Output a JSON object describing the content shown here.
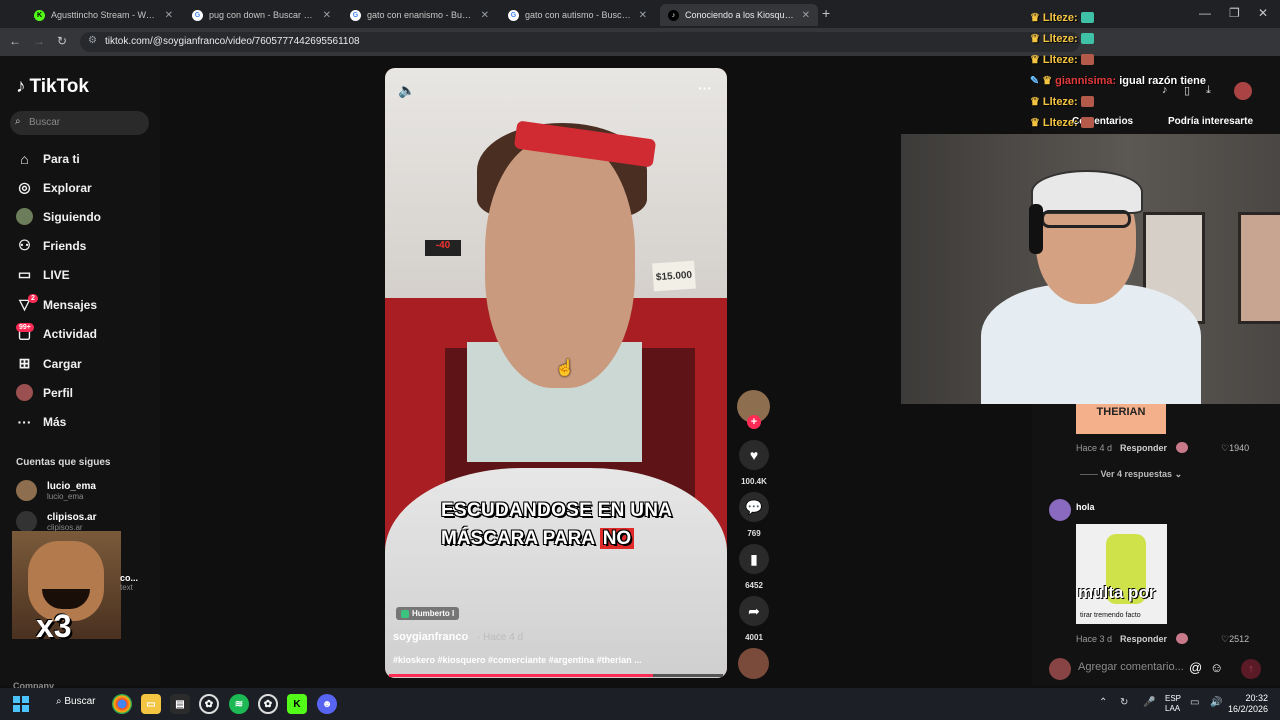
{
  "browser": {
    "tabs": [
      {
        "title": "Agusttincho Stream - Watch Li",
        "favicon": "kick-icon",
        "color": "#53fc18"
      },
      {
        "title": "pug con down - Buscar con Go",
        "favicon": "google-icon",
        "color": "#4285f4"
      },
      {
        "title": "gato con enanismo - Buscar co",
        "favicon": "google-icon",
        "color": "#4285f4"
      },
      {
        "title": "gato con autismo - Buscar con",
        "favicon": "google-icon",
        "color": "#4285f4"
      },
      {
        "title": "Conociendo a los Kiosqueros d",
        "favicon": "tiktok-icon",
        "color": "#ffffff"
      }
    ],
    "url": "tiktok.com/@soygianfranco/video/7605777442695561108"
  },
  "tiktok": {
    "logo": "TikTok",
    "search_placeholder": "Buscar",
    "nav": [
      {
        "label": "Para ti",
        "icon": "home-icon"
      },
      {
        "label": "Explorar",
        "icon": "compass-icon"
      },
      {
        "label": "Siguiendo",
        "icon": "following-avatar-icon"
      },
      {
        "label": "Friends",
        "icon": "friends-icon"
      },
      {
        "label": "LIVE",
        "icon": "live-icon"
      },
      {
        "label": "Mensajes",
        "icon": "messages-icon",
        "badge": "2"
      },
      {
        "label": "Actividad",
        "icon": "activity-icon",
        "badge": "99+"
      },
      {
        "label": "Cargar",
        "icon": "upload-icon"
      },
      {
        "label": "Perfil",
        "icon": "profile-avatar-icon"
      },
      {
        "label": "Más",
        "icon": "more-icon"
      }
    ],
    "following_title": "Cuentas que sigues",
    "following": [
      {
        "name": "lucio_ema",
        "handle": "lucio_ema"
      },
      {
        "name": "clipisos.ar",
        "handle": "clipisos.ar"
      }
    ],
    "meme_overlay": {
      "text": "x3",
      "side_name": "co...",
      "side_handle": "text"
    },
    "footer": "Company"
  },
  "video": {
    "caption_line1": "ESCUDANDOSE EN UNA",
    "caption_line2_pre": "MÁSCARA PARA",
    "caption_line2_hl": "NO",
    "price_tag": "$15.000",
    "digits": "-40",
    "music_tag": "Humberto l",
    "author": "soygianfranco",
    "ago": "· Hace 4 d",
    "hashtags": "#kioskero #kiosquero #comerciante #argentina #therian ...",
    "progress": 0.79
  },
  "rail": {
    "likes": "100.4K",
    "comments": "769",
    "saves": "6452",
    "shares": "4001"
  },
  "chat": [
    {
      "user": "Llteze:",
      "emote_color": "#3fc1a8"
    },
    {
      "user": "Llteze:",
      "emote_color": "#3fc1a8"
    },
    {
      "user": "Llteze:",
      "emote_color": "#b35a4a"
    },
    {
      "user": "giannisima:",
      "message": "igual razón tiene"
    },
    {
      "user": "Llteze:",
      "emote_color": "#b35a4a"
    },
    {
      "user": "Llteze:",
      "emote_color": "#b35a4a"
    }
  ],
  "comments_panel": {
    "tab_comments": "Comentarios",
    "tab_suggest": "Podría interesarte",
    "c1": {
      "image_text": "THERIAN",
      "ago": "Hace 4 d",
      "reply": "Responder",
      "likes": "1940"
    },
    "view_replies": "Ver 4 respuestas",
    "c2": {
      "name": "hola",
      "image_text": "multa por",
      "image_sub": "tirar tremendo facto",
      "ago": "Hace 3 d",
      "reply": "Responder",
      "likes": "2512"
    },
    "add_placeholder": "Agregar comentario..."
  },
  "taskbar": {
    "search": "Buscar",
    "lang1": "ESP",
    "lang2": "LAA",
    "time": "20:32",
    "date": "16/2/2026"
  }
}
